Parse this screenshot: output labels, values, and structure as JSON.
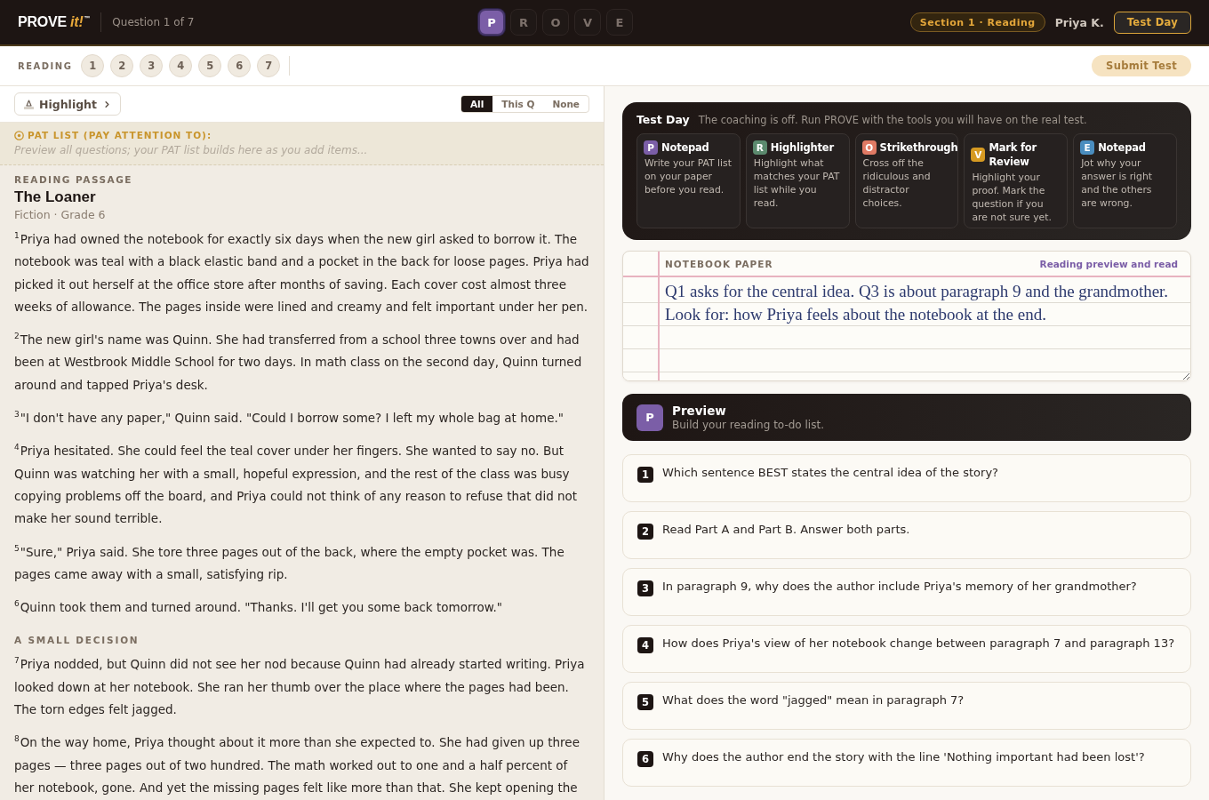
{
  "header": {
    "logo": {
      "wordmark": "PROVE",
      "accent": "it!",
      "mark": "™"
    },
    "question_counter": "Question 1 of 7",
    "steps": [
      {
        "letter": "P",
        "selected": true
      },
      {
        "letter": "R",
        "selected": false
      },
      {
        "letter": "O",
        "selected": false
      },
      {
        "letter": "V",
        "selected": false
      },
      {
        "letter": "E",
        "selected": false
      }
    ],
    "section_badge": "Section 1 · Reading",
    "user_name": "Priya K.",
    "mode_button": "Test Day"
  },
  "question_nav": {
    "label": "READING",
    "questions": [
      "1",
      "2",
      "3",
      "4",
      "5",
      "6",
      "7"
    ],
    "submit_button": {
      "label": "Submit Test",
      "disabled": true
    }
  },
  "passage_toolbar": {
    "highlight_button": "Highlight",
    "filter": [
      {
        "label": "All",
        "selected": true
      },
      {
        "label": "This Q",
        "selected": false
      },
      {
        "label": "None",
        "selected": false
      }
    ]
  },
  "pat_list": {
    "title": "PAT LIST (PAY ATTENTION TO):",
    "empty_message": "Preview all questions; your PAT list builds here as you add items..."
  },
  "passage": {
    "label": "READING PASSAGE",
    "title": "The Loaner",
    "meta": "Fiction · Grade 6",
    "blocks": [
      {
        "kind": "paragraph",
        "text": "$^{1}$Priya had owned the notebook for exactly six days when the new girl asked to borrow it. The notebook was teal with a black elastic band and a pocket in the back for loose pages. Priya had picked it out herself at the office store after months of saving. Each cover cost almost three weeks of allowance. The pages inside were lined and creamy and felt important under her pen."
      },
      {
        "kind": "paragraph",
        "text": "$^{2}$The new girl's name was Quinn. She had transferred from a school three towns over and had been at Westbrook Middle School for two days. In math class on the second day, Quinn turned around and tapped Priya's desk."
      },
      {
        "kind": "paragraph",
        "text": "$^{3}$\"I don't have any paper,\" Quinn said. \"Could I borrow some? I left my whole bag at home.\""
      },
      {
        "kind": "paragraph",
        "text": "$^{4}$Priya hesitated. She could feel the teal cover under her fingers. She wanted to say no. But Quinn was watching her with a small, hopeful expression, and the rest of the class was busy copying problems off the board, and Priya could not think of any reason to refuse that did not make her sound terrible."
      },
      {
        "kind": "paragraph",
        "text": "$^{5}$\"Sure,\" Priya said. She tore three pages out of the back, where the empty pocket was. The pages came away with a small, satisfying rip."
      },
      {
        "kind": "paragraph",
        "text": "$^{6}$Quinn took them and turned around. \"Thanks. I'll get you some back tomorrow.\""
      },
      {
        "kind": "heading",
        "text": "A SMALL DECISION"
      },
      {
        "kind": "paragraph",
        "text": "$^{7}$Priya nodded, but Quinn did not see her nod because Quinn had already started writing. Priya looked down at her notebook. She ran her thumb over the place where the pages had been. The torn edges felt jagged."
      },
      {
        "kind": "paragraph",
        "text": "$^{8}$On the way home, Priya thought about it more than she expected to. She had given up three pages — three pages out of two hundred. The math worked out to one and a half percent of her notebook, gone. And yet the missing pages felt like more than that. She kept opening the"
      }
    ]
  },
  "coaching": {
    "title": "Test Day",
    "subtitle": "The coaching is off. Run PROVE with the tools you will have on the real test.",
    "tools": [
      {
        "letter": "P",
        "name": "Notepad",
        "description": "Write your PAT list on your paper before you read.",
        "color": "#7b5ea7"
      },
      {
        "letter": "R",
        "name": "Highlighter",
        "description": "Highlight what matches your PAT list while you read.",
        "color": "#5b8a6e"
      },
      {
        "letter": "O",
        "name": "Strikethrough",
        "description": "Cross off the ridiculous and distractor choices.",
        "color": "#e07a64"
      },
      {
        "letter": "V",
        "name": "Mark for Review",
        "description": "Highlight your proof. Mark the question if you are not sure yet.",
        "color": "#d69a22"
      },
      {
        "letter": "E",
        "name": "Notepad",
        "description": "Jot why your answer is right and the others are wrong.",
        "color": "#4a8dbf"
      }
    ]
  },
  "notebook": {
    "label": "NOTEBOOK PAPER",
    "stage": "Reading preview and read",
    "value": "Q1 asks for the central idea. Q3 is about paragraph 9 and the grandmother. Look for: how Priya feels about the notebook at the end."
  },
  "step_banner": {
    "letter": "P",
    "title": "Preview",
    "subtitle": "Build your reading to-do list."
  },
  "questions": [
    {
      "number": "1",
      "text": "Which sentence BEST states the central idea of the story?"
    },
    {
      "number": "2",
      "text": "Read Part A and Part B. Answer both parts."
    },
    {
      "number": "3",
      "text": "In paragraph 9, why does the author include Priya's memory of her grandmother?"
    },
    {
      "number": "4",
      "text": "How does Priya's view of her notebook change between paragraph 7 and paragraph 13?"
    },
    {
      "number": "5",
      "text": "What does the word \"jagged\" mean in paragraph 7?"
    },
    {
      "number": "6",
      "text": "Why does the author end the story with the line 'Nothing important had been lost'?"
    }
  ]
}
